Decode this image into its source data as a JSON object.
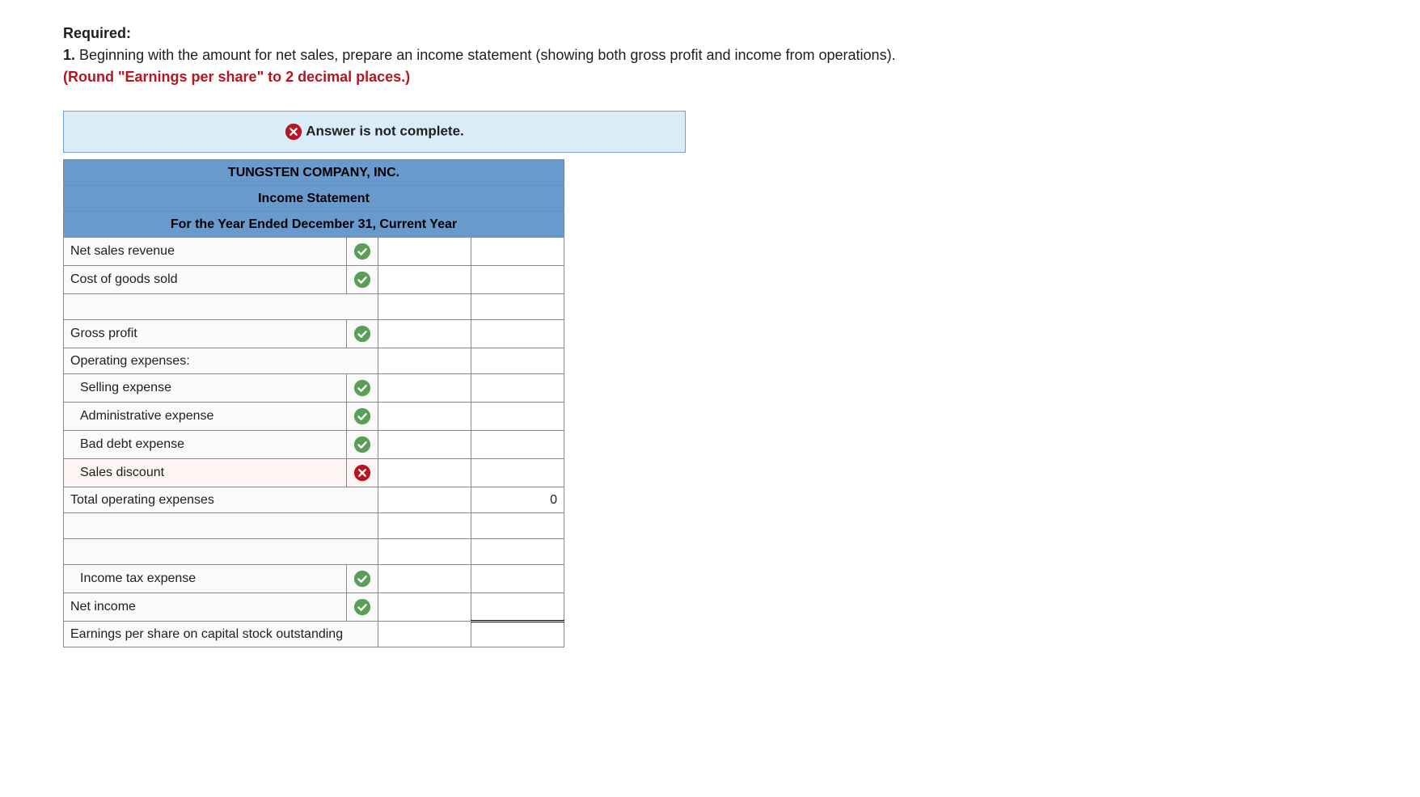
{
  "intro": {
    "required_label": "Required:",
    "item_prefix": "1. ",
    "item_text": "Beginning with the amount for net sales, prepare an income statement (showing both gross profit and income from operations).",
    "round_note": "(Round \"Earnings per share\" to 2 decimal places.)"
  },
  "banner": {
    "text": "Answer is not complete."
  },
  "headers": {
    "company": "TUNGSTEN COMPANY, INC.",
    "title": "Income Statement",
    "period": "For the Year Ended December 31, Current Year"
  },
  "rows": {
    "net_sales": "Net sales revenue",
    "cogs": "Cost of goods sold",
    "gross_profit": "Gross profit",
    "op_exp_header": "Operating expenses:",
    "selling": "Selling expense",
    "admin": "Administrative expense",
    "bad_debt": "Bad debt expense",
    "sales_discount": "Sales discount",
    "total_op": "Total operating expenses",
    "total_op_val": "0",
    "income_tax": "Income tax expense",
    "net_income": "Net income",
    "eps": "Earnings per share on capital stock outstanding"
  }
}
